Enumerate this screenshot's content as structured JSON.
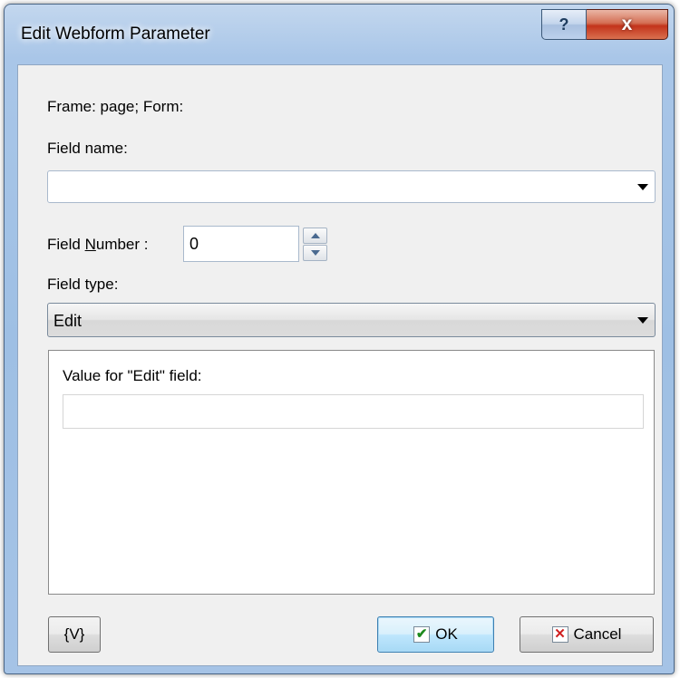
{
  "window": {
    "title": "Edit Webform Parameter",
    "help_glyph": "?",
    "close_glyph": "x"
  },
  "frame_info": "Frame: page; Form:",
  "field_name": {
    "label": "Field name:",
    "value": ""
  },
  "field_number": {
    "label_pre": "Field ",
    "label_accel": "N",
    "label_post": "umber :",
    "value": "0"
  },
  "field_type": {
    "label": "Field type:",
    "selected": "Edit"
  },
  "value_panel": {
    "label": "Value for \"Edit\" field:",
    "value": ""
  },
  "buttons": {
    "variables": "{V}",
    "ok": "OK",
    "cancel": "Cancel",
    "ok_icon": "checkmark-icon",
    "cancel_icon": "x-mark-icon"
  },
  "colors": {
    "title_bar": "#a9c6e8",
    "close_button": "#c3331b",
    "dialog_bg": "#f0f0f0",
    "ok_border": "#3c7fb1"
  }
}
